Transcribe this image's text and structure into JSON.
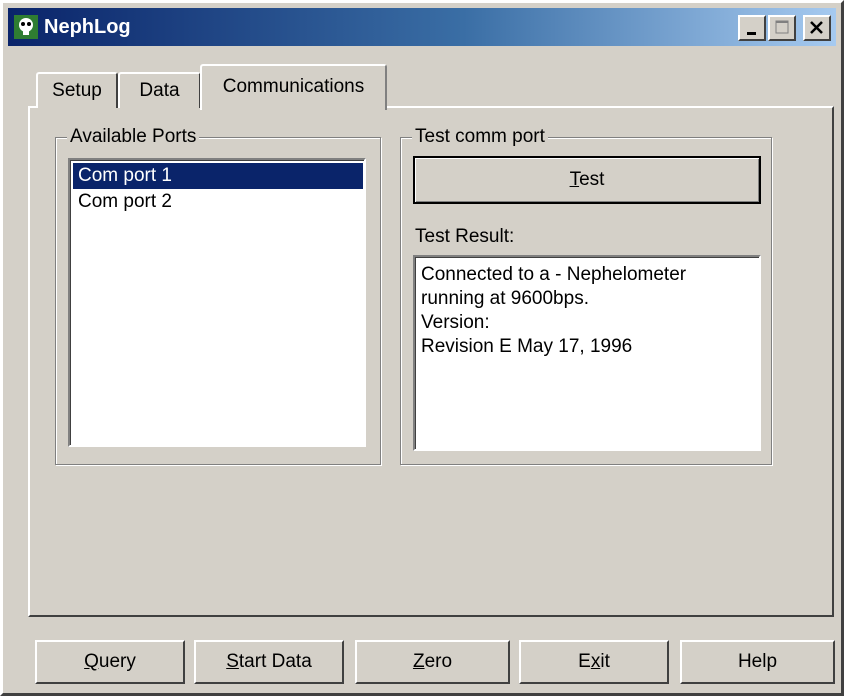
{
  "window": {
    "title": "NephLog",
    "controls": {
      "minimize": "minimize",
      "maximize": "maximize",
      "close": "close"
    }
  },
  "tabs": [
    {
      "label": "Setup",
      "active": false
    },
    {
      "label": "Data",
      "active": false
    },
    {
      "label": "Communications",
      "active": true
    }
  ],
  "ports": {
    "legend": "Available Ports",
    "items": [
      {
        "label": "Com port 1",
        "selected": true
      },
      {
        "label": "Com port 2",
        "selected": false
      }
    ]
  },
  "test": {
    "legend": "Test comm port",
    "button_mnemonic": "T",
    "button_rest": "est",
    "result_label": "Test Result:",
    "result_text": "Connected to a - Nephelometer\nrunning at 9600bps.\nVersion:\nRevision E May 17, 1996"
  },
  "bottom_buttons": {
    "query": {
      "mnemonic": "Q",
      "rest": "uery"
    },
    "start": {
      "mnemonic": "S",
      "rest": "tart Data"
    },
    "zero": {
      "mnemonic": "Z",
      "rest": "ero"
    },
    "exit": {
      "before": "E",
      "mnemonic": "x",
      "after": "it"
    },
    "help": {
      "label": "Help"
    }
  },
  "colors": {
    "face": "#d4d0c8",
    "titlebar_start": "#0a246a",
    "titlebar_end": "#a6caf0",
    "selection": "#0a246a"
  },
  "icons": {
    "app": "nephlog-app-icon",
    "minimize": "minimize-icon",
    "maximize": "maximize-icon",
    "close": "close-icon"
  }
}
